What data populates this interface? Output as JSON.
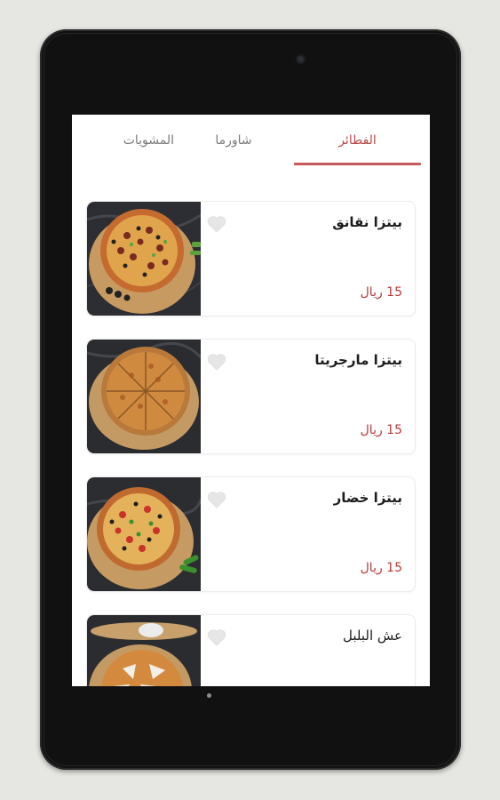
{
  "tabs": [
    {
      "label": "الفطائر",
      "active": true
    },
    {
      "label": "شاورما",
      "active": false
    },
    {
      "label": "المشويات",
      "active": false
    }
  ],
  "items": [
    {
      "name": "بيتزا نقانق",
      "price": "15 ريال"
    },
    {
      "name": "بيتزا مارجريتا",
      "price": "15 ريال"
    },
    {
      "name": "بيتزا خضار",
      "price": "15 ريال"
    },
    {
      "name": "عش البلبل",
      "price": ""
    }
  ],
  "colors": {
    "accent": "#c45a5a",
    "price": "#b83a3a",
    "tablet_bezel": "#111111",
    "background": "#e6e7e2"
  },
  "icons": {
    "favorite": "heart-outline-icon"
  }
}
